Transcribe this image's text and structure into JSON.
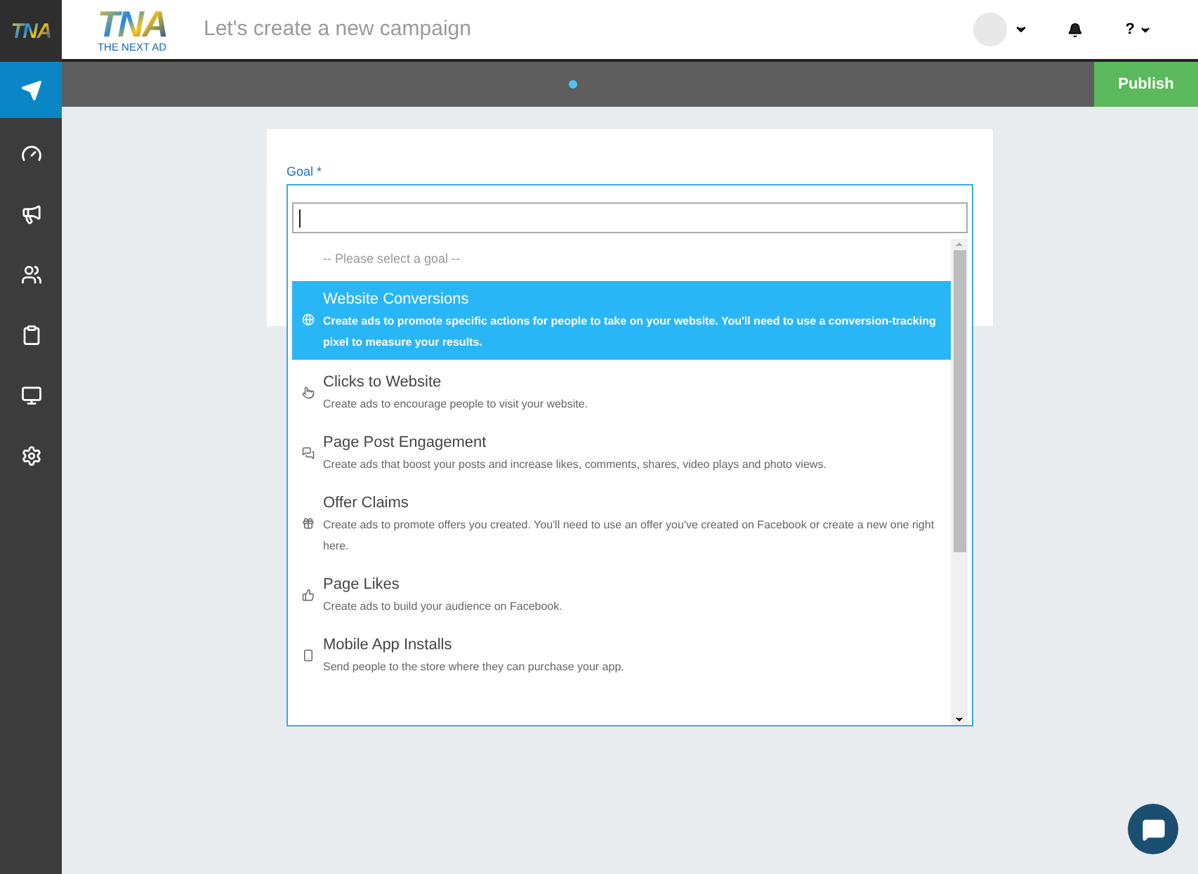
{
  "sidebar": {
    "logo": "TNA",
    "items": [
      {
        "kind": "send",
        "selected": true
      },
      {
        "kind": "gauge",
        "selected": false
      },
      {
        "kind": "megaphone",
        "selected": false
      },
      {
        "kind": "users",
        "selected": false
      },
      {
        "kind": "clipboard",
        "selected": false
      },
      {
        "kind": "monitor",
        "selected": false
      },
      {
        "kind": "settings",
        "selected": false
      }
    ]
  },
  "header": {
    "logo": "TNA",
    "logo_tagline": "THE NEXT AD",
    "title": "Let's create a new campaign",
    "help": "?"
  },
  "toolbar": {
    "publish": "Publish"
  },
  "form": {
    "label": "Goal *",
    "search": {
      "cursor": true
    },
    "placeholder_option": "-- Please select a goal --",
    "options": [
      {
        "kind": "globe",
        "title": "Website Conversions",
        "description": "Create ads to promote specific actions for people to take on your website. You'll need to use a conversion-tracking pixel to measure your results.",
        "selected": true
      },
      {
        "kind": "pointer",
        "title": "Clicks to Website",
        "description": "Create ads to encourage people to visit your website.",
        "selected": false
      },
      {
        "kind": "comments",
        "title": "Page Post Engagement",
        "description": "Create ads that boost your posts and increase likes, comments, shares, video plays and photo views.",
        "selected": false
      },
      {
        "kind": "gift",
        "title": "Offer Claims",
        "description": "Create ads to promote offers you created. You'll need to use an offer you've created on Facebook or create a new one right here.",
        "selected": false
      },
      {
        "kind": "thumbs",
        "title": "Page Likes",
        "description": "Create ads to build your audience on Facebook.",
        "selected": false
      },
      {
        "kind": "mobile",
        "title": "Mobile App Installs",
        "description": "Send people to the store where they can purchase your app.",
        "selected": false
      }
    ]
  }
}
